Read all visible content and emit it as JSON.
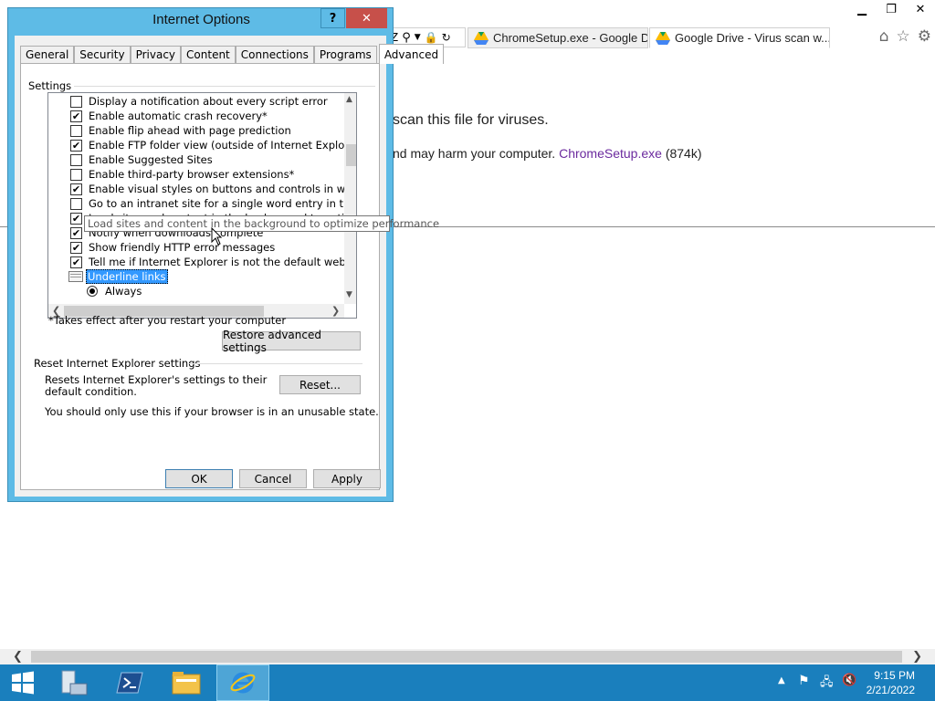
{
  "browser": {
    "tabs": [
      {
        "label": "ChromeSetup.exe - Google Drive"
      },
      {
        "label": "Google Drive - Virus scan w..."
      }
    ],
    "address_fragment": "Z"
  },
  "page": {
    "heading_fragment": "scan this file for viruses.",
    "warning_fragment": "nd may harm your computer.",
    "file_link": "ChromeSetup.exe",
    "file_size": "(874k)"
  },
  "dialog": {
    "title": "Internet Options",
    "help": "?",
    "close": "✕",
    "tabs": [
      "General",
      "Security",
      "Privacy",
      "Content",
      "Connections",
      "Programs",
      "Advanced"
    ],
    "settings_label": "Settings",
    "settings": [
      {
        "label": "Display a notification about every script error",
        "checked": false
      },
      {
        "label": "Enable automatic crash recovery*",
        "checked": true
      },
      {
        "label": "Enable flip ahead with page prediction",
        "checked": false
      },
      {
        "label": "Enable FTP folder view (outside of Internet Explorer)",
        "checked": true
      },
      {
        "label": "Enable Suggested Sites",
        "checked": false
      },
      {
        "label": "Enable third-party browser extensions*",
        "checked": false
      },
      {
        "label": "Enable visual styles on buttons and controls in webpages",
        "checked": true
      },
      {
        "label": "Go to an intranet site for a single word entry in the Addres",
        "checked": false
      },
      {
        "label": "Load sites and content in the background to optimize performance",
        "checked": true
      },
      {
        "label": "Notify when downloads complete",
        "checked": true
      },
      {
        "label": "Show friendly HTTP error messages",
        "checked": true
      },
      {
        "label": "Tell me if Internet Explorer is not the default web browser",
        "checked": true
      }
    ],
    "underline_links": "Underline links",
    "always": "Always",
    "tooltip": "Load sites and content in the background to optimize performance",
    "restart_note": "*Takes effect after you restart your computer",
    "restore_button": "Restore advanced settings",
    "reset_group_label": "Reset Internet Explorer settings",
    "reset_desc": "Resets Internet Explorer's settings to their default condition.",
    "reset_button": "Reset...",
    "reset_warning": "You should only use this if your browser is in an unusable state.",
    "ok": "OK",
    "cancel": "Cancel",
    "apply": "Apply"
  },
  "taskbar": {
    "time": "9:15 PM",
    "date": "2/21/2022"
  },
  "colors": {
    "dialog_frame": "#5ebbe6",
    "taskbar": "#1a7fbd",
    "link": "#6b2a9e",
    "selection": "#3399ff"
  }
}
